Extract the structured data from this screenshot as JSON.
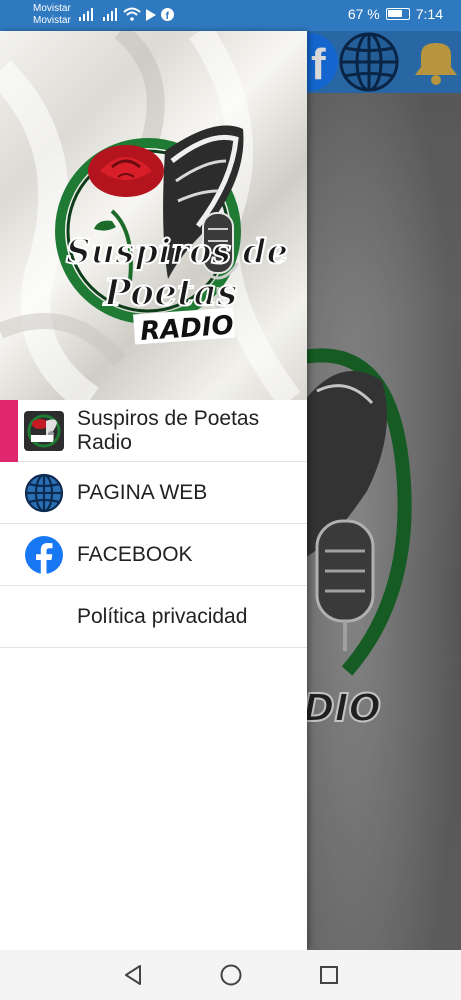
{
  "status_bar": {
    "carrier_1": "Movistar",
    "carrier_2": "Movistar",
    "battery_text": "67 %",
    "time": "7:14"
  },
  "drawer": {
    "header_logo": {
      "line1": "Suspiros de",
      "line2": "Poetas",
      "line3": "RADIO"
    },
    "items": [
      {
        "label": "Suspiros de Poetas Radio",
        "icon": "station-logo-icon",
        "selected": true
      },
      {
        "label": "PAGINA WEB",
        "icon": "globe-icon"
      },
      {
        "label": "FACEBOOK",
        "icon": "facebook-icon"
      },
      {
        "label": "Política privacidad",
        "icon": ""
      }
    ]
  },
  "background_app": {
    "toolbar_icons": [
      "facebook-icon",
      "globe-icon",
      "bell-icon"
    ],
    "background_logo": {
      "text": "DIO"
    }
  },
  "nav_bar": {
    "buttons": [
      "back-icon",
      "home-icon",
      "recents-icon"
    ]
  },
  "colors": {
    "status_bar": "#2f79c0",
    "selected_indicator": "#e0266d",
    "globe_blue": "#2a6fb3",
    "facebook_blue": "#1877f2"
  }
}
